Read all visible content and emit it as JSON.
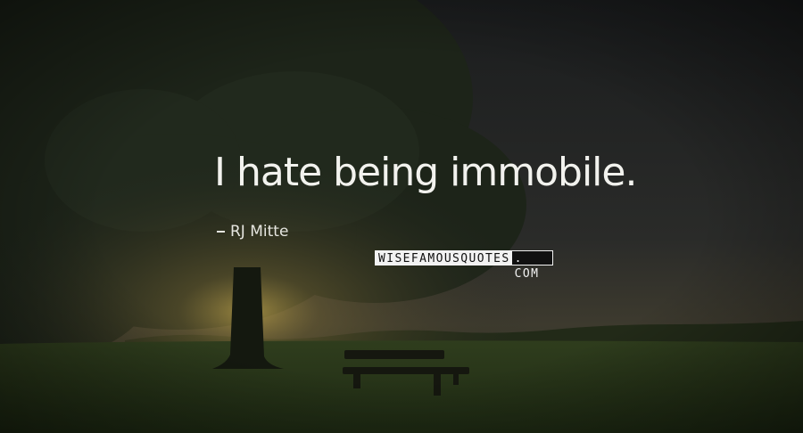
{
  "quote": {
    "text": "I hate being immobile.",
    "author": "RJ Mitte"
  },
  "watermark": {
    "part1": "WISEFAMOUSQUOTES",
    "part2": ". COM"
  },
  "colors": {
    "text": "#f2f2ee",
    "sky_dark": "#1a1c1d",
    "grass": "#28371a",
    "sun_glow": "#a0883c"
  }
}
